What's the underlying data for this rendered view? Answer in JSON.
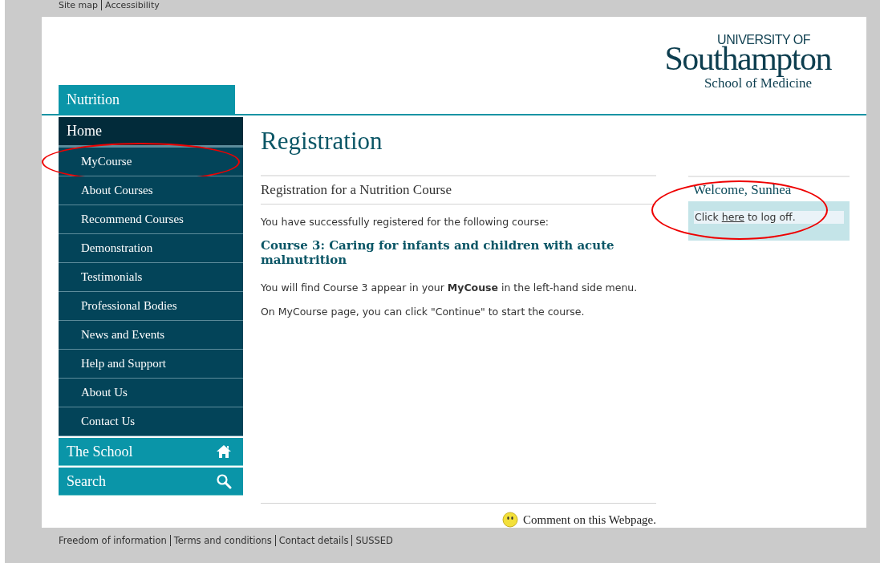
{
  "top_links": [
    "Site map",
    "Accessibility"
  ],
  "logo": {
    "line1": "UNIVERSITY OF",
    "line2": "Southampton",
    "line3": "School of Medicine"
  },
  "sidebar": {
    "section": "Nutrition",
    "items": [
      {
        "label": "Home",
        "kind": "top",
        "circled": false
      },
      {
        "label": "MyCourse",
        "kind": "sub",
        "circled": true
      },
      {
        "label": "About Courses",
        "kind": "sub",
        "circled": false
      },
      {
        "label": "Recommend Courses",
        "kind": "sub",
        "circled": false
      },
      {
        "label": "Demonstration",
        "kind": "sub",
        "circled": false
      },
      {
        "label": "Testimonials",
        "kind": "sub",
        "circled": false
      },
      {
        "label": "Professional Bodies",
        "kind": "sub",
        "circled": false
      },
      {
        "label": "News and Events",
        "kind": "sub",
        "circled": false
      },
      {
        "label": "Help and Support",
        "kind": "sub",
        "circled": false
      },
      {
        "label": "About Us",
        "kind": "sub",
        "circled": false
      },
      {
        "label": "Contact Us",
        "kind": "sub",
        "circled": false
      }
    ],
    "bottom_links": [
      {
        "label": "The School",
        "kind": "school"
      },
      {
        "label": "Search",
        "kind": "search"
      }
    ]
  },
  "main": {
    "title": "Registration",
    "subtitle": "Registration for a Nutrition Course",
    "intro": "You have successfully registered for the following course:",
    "course_title": "Course 3: Caring for infants and children with acute malnutrition",
    "paragraphs": [
      "You will find Course 3 appear in your **MyCouse** in the left-hand side menu.",
      "On MyCourse page, you can click \"Continue\" to start the course."
    ],
    "comment_link": "Comment on this Webpage."
  },
  "welcome": {
    "title": "Welcome, Sunhea",
    "before": "Click ",
    "link": "here",
    "after": " to log off.",
    "circled": true
  },
  "footer_links": [
    "Freedom of information",
    "Terms and conditions",
    "Contact details",
    "SUSSED"
  ]
}
